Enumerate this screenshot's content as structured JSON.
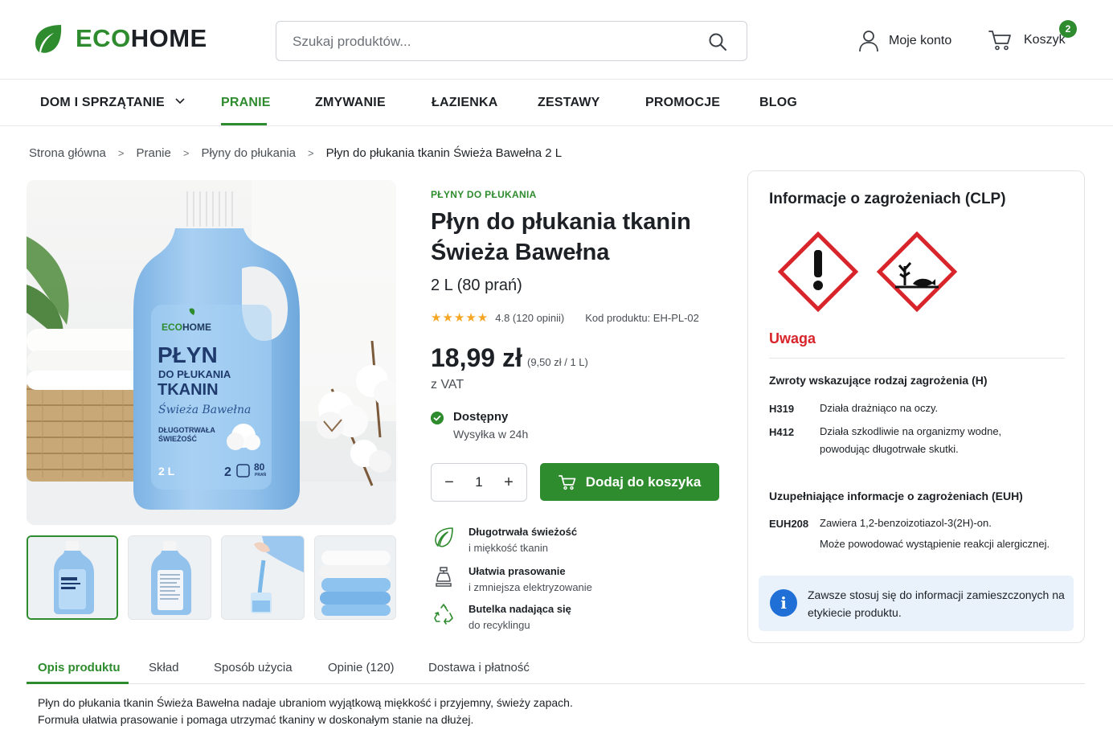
{
  "header": {
    "logo_eco": "ECO",
    "logo_home": "HOME",
    "search_placeholder": "Szukaj produktów...",
    "account_label": "Moje konto",
    "cart_label": "Koszyk",
    "cart_count": "2"
  },
  "nav": {
    "items": [
      {
        "label": "DOM I SPRZĄTANIE",
        "has_dropdown": true
      },
      {
        "label": "PRANIE",
        "active": true
      },
      {
        "label": "ZMYWANIE"
      },
      {
        "label": "ŁAZIENKA"
      },
      {
        "label": "ZESTAWY"
      },
      {
        "label": "PROMOCJE"
      },
      {
        "label": "BLOG"
      }
    ]
  },
  "breadcrumb": [
    "Strona główna",
    "Pranie",
    "Płyny do płukania",
    "Płyn do płukania tkanin Świeża Bawełna 2 L"
  ],
  "product": {
    "category": "PŁYNY DO PŁUKANIA",
    "title": "Płyn do płukania tkanin Świeża Bawełna",
    "variant": "2 L (80 prań)",
    "rating": "4.8",
    "rating_text": "4.8 (120 opinii)",
    "rating_stars": 4.8,
    "code_text": "Kod produktu: EH-PL-02",
    "price": "18,99 zł",
    "unit_price": "(9,50 zł / 1 L)",
    "vat": "z VAT",
    "stock_label": "Dostępny",
    "stock_sub": "Wysyłka w 24h",
    "quantity": "1",
    "add_to_cart": "Dodaj do koszyka",
    "features": [
      {
        "icon": "leaf-icon",
        "title": "Długotrwała świeżość",
        "sub": "i miękkość tkanin"
      },
      {
        "icon": "iron-icon",
        "title": "Ułatwia prasowanie",
        "sub": "i zmniejsza elektryzowanie"
      },
      {
        "icon": "recycle-icon",
        "title": "Butelka nadająca się",
        "sub": "do recyklingu"
      }
    ],
    "bottle": {
      "brand_eco": "ECO",
      "brand_home": "HOME",
      "line1": "PŁYN",
      "line2": "DO PŁUKANIA",
      "line3": "TKANIN",
      "line4": "Świeża Bawełna",
      "line5": "DŁUGOTRWAŁA",
      "line6": "ŚWIEŻOŚĆ",
      "volume": "2 L",
      "washes": "80",
      "washes_label": "PRAŃ",
      "dose": "2"
    }
  },
  "hazard": {
    "title": "Informacje o zagrożeniach (CLP)",
    "pictograms": [
      "exclamation-pictogram",
      "environment-pictogram"
    ],
    "signal_word": "Uwaga",
    "h_heading": "Zwroty wskazujące rodzaj zagrożenia (H)",
    "h_statements": [
      {
        "code": "H319",
        "text": "Działa drażniąco na oczy."
      },
      {
        "code": "H412",
        "text": "Działa szkodliwie na organizmy wodne, powodując długotrwałe skutki."
      }
    ],
    "euh_heading": "Uzupełniające informacje o zagrożeniach (EUH)",
    "euh_statements": [
      {
        "code": "EUH208",
        "text": "Zawiera 1,2-benzoizotiazol-3(2H)-on.",
        "text2": "Może powodować wystąpienie reakcji alergicznej."
      }
    ],
    "info_text": "Zawsze stosuj się do informacji zamieszczonych na etykiecie produktu."
  },
  "tabs": [
    {
      "label": "Opis produktu",
      "active": true
    },
    {
      "label": "Skład"
    },
    {
      "label": "Sposób użycia"
    },
    {
      "label": "Opinie (120)"
    },
    {
      "label": "Dostawa i płatność"
    }
  ],
  "description": {
    "line1": "Płyn do płukania tkanin Świeża Bawełna nadaje ubraniom wyjątkową miękkość i przyjemny, świeży zapach.",
    "line2": "Formuła ułatwia prasowanie i pomaga utrzymać tkaniny w doskonałym stanie na dłużej."
  },
  "colors": {
    "brand_green": "#2e8b2e",
    "hazard_red": "#d8242b",
    "info_blue": "#1f6fd6",
    "star": "#f5a623"
  }
}
